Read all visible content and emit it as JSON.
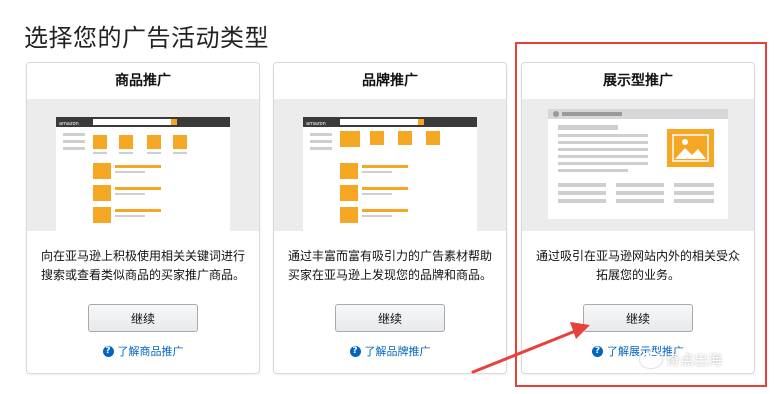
{
  "page": {
    "title": "选择您的广告活动类型"
  },
  "cards": [
    {
      "title": "商品推广",
      "description": "向在亚马逊上积极使用相关关键词进行搜索或查看类似商品的买家推广商品。",
      "button_label": "继续",
      "link_label": "了解商品推广",
      "illustration_logo": "amazon"
    },
    {
      "title": "品牌推广",
      "description": "通过丰富而富有吸引力的广告素材帮助买家在亚马逊上发现您的品牌和商品。",
      "button_label": "继续",
      "link_label": "了解品牌推广",
      "illustration_logo": "amazon"
    },
    {
      "title": "展示型推广",
      "description": "通过吸引在亚马逊网站内外的相关受众拓展您的业务。",
      "button_label": "继续",
      "link_label": "了解展示型推广"
    }
  ],
  "help_icon_glyph": "?",
  "watermark": {
    "text": "奇点出海"
  },
  "colors": {
    "accent_orange": "#f5a623",
    "link_blue": "#0066c0",
    "highlight_red": "#e8403a",
    "illustration_bg": "#ececec",
    "mock_dark_bar": "#3a3a3a",
    "mock_gray": "#cfcfcf"
  },
  "icons": [
    "help-icon",
    "image-placeholder-icon",
    "mountain-sun-icon",
    "watermark-logo-icon"
  ]
}
